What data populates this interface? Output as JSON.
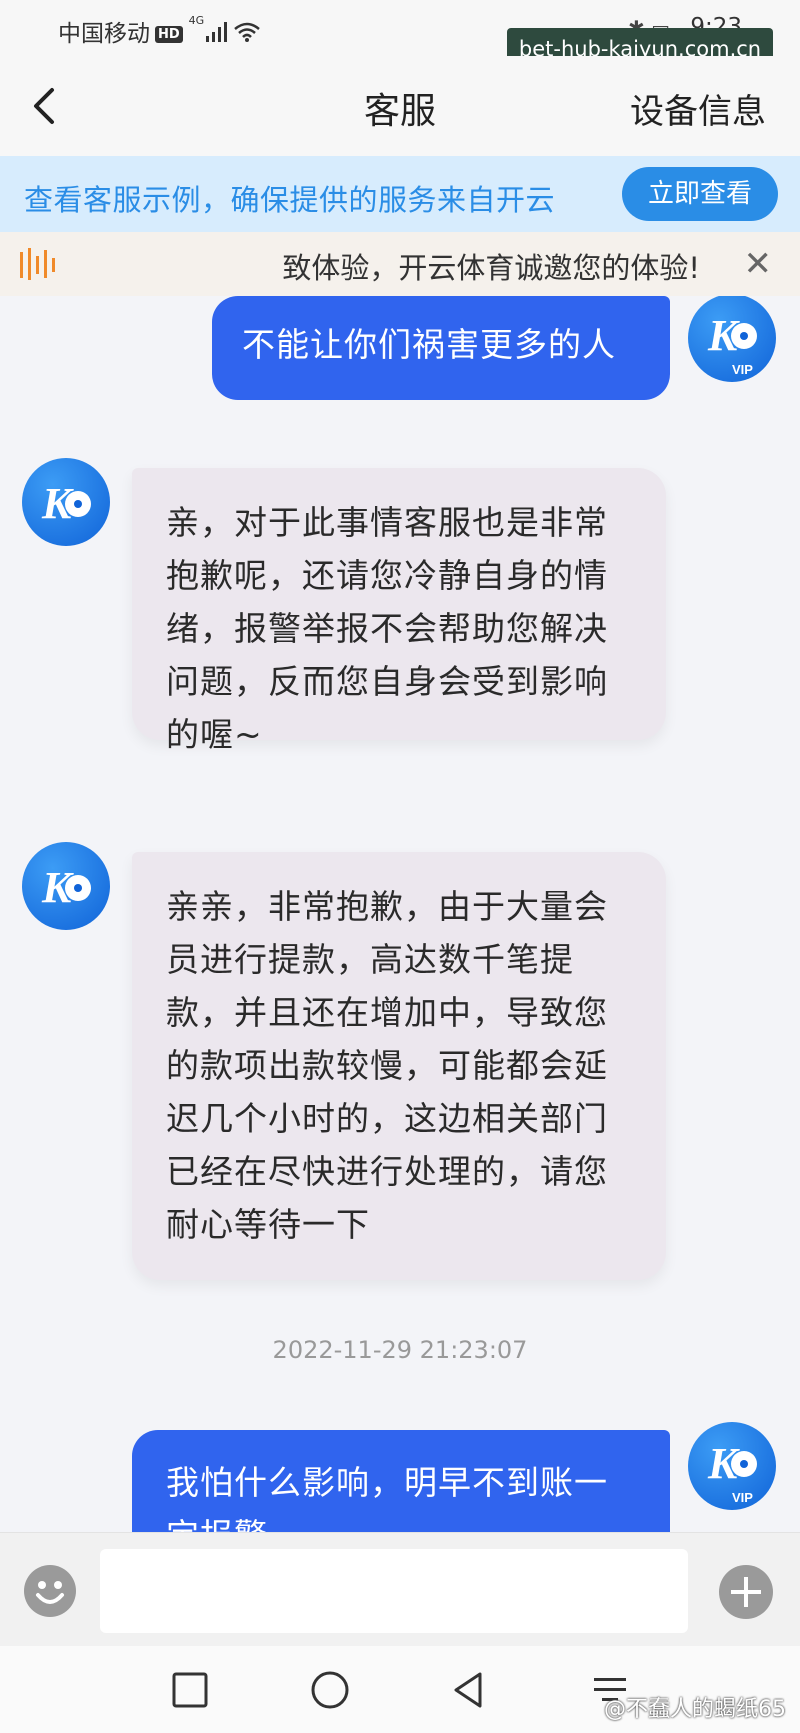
{
  "status_bar": {
    "carrier": "中国移动",
    "hd_badge": "HD",
    "network": "4G",
    "time": "9:23"
  },
  "watermark_top": "bet-hub-kaiyun.com.cn",
  "nav": {
    "title": "客服",
    "action": "设备信息"
  },
  "notice": {
    "text": "查看客服示例，确保提供的服务来自开云",
    "button": "立即查看"
  },
  "marquee": {
    "text": "致体验，开云体育诚邀您的体验!"
  },
  "messages": [
    {
      "sender": "user",
      "text": "不能让你们祸害更多的人",
      "avatar_badge": "VIP"
    },
    {
      "sender": "agent",
      "text": "亲，对于此事情客服也是非常抱歉呢，还请您冷静自身的情绪，报警举报不会帮助您解决问题，反而您自身会受到影响的喔~"
    },
    {
      "sender": "agent",
      "text": "亲亲，非常抱歉，由于大量会员进行提款，高达数千笔提款，并且还在增加中，导致您的款项出款较慢，可能都会延迟几个小时的，这边相关部门已经在尽快进行处理的，请您耐心等待一下"
    },
    {
      "sender": "timestamp",
      "text": "2022-11-29 21:23:07"
    },
    {
      "sender": "user",
      "text": "我怕什么影响，明早不到账一定报警",
      "avatar_badge": "VIP"
    }
  ],
  "input": {
    "placeholder": ""
  },
  "watermark_bottom": "@不蠢人的蝎纸65",
  "colors": {
    "accent": "#2a8de6",
    "user_bubble": "#3064ee",
    "agent_bubble": "#ece7ee"
  },
  "icons": [
    "back-icon",
    "close-icon",
    "emoji-icon",
    "add-icon",
    "square-icon",
    "circle-icon",
    "triangle-back-icon",
    "menu-icon"
  ]
}
